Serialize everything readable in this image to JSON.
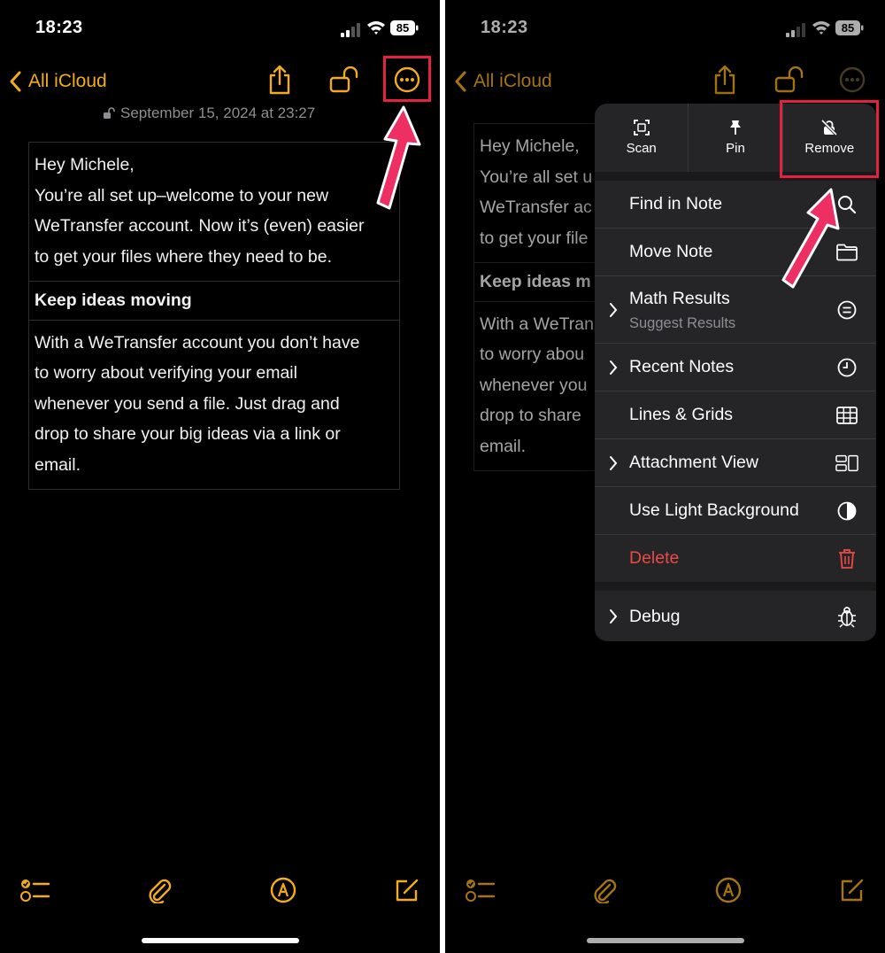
{
  "status": {
    "time": "18:23",
    "battery": "85"
  },
  "nav": {
    "back_label": "All iCloud"
  },
  "note": {
    "date": "September 15, 2024 at 23:27",
    "intro_lines": [
      "Hey Michele,",
      "You’re all set up–welcome to your new",
      "WeTransfer account. Now it’s (even) easier",
      "to get your files where they need to be."
    ],
    "heading": "Keep ideas moving",
    "body_lines": [
      "With a WeTransfer account you don’t have",
      "to worry about verifying your email",
      "whenever you send a file. Just drag and",
      "drop to share your big ideas via a link or",
      "email."
    ]
  },
  "right_note": {
    "intro_lines": [
      "Hey Michele,",
      "You’re all set u",
      "WeTransfer ac",
      "to get your file"
    ],
    "heading": "Keep ideas m",
    "body_lines": [
      "With a WeTran",
      "to worry abou",
      "whenever you",
      "drop to share",
      "email."
    ]
  },
  "menu": {
    "quick_actions": [
      {
        "label": "Scan",
        "icon": "scan-icon"
      },
      {
        "label": "Pin",
        "icon": "pin-icon"
      },
      {
        "label": "Remove",
        "icon": "lock-slash-icon"
      }
    ],
    "items": [
      {
        "label": "Find in Note",
        "icon": "search-icon"
      },
      {
        "label": "Move Note",
        "icon": "folder-icon"
      },
      {
        "label": "Math Results",
        "sublabel": "Suggest Results",
        "icon": "equals-circle-icon"
      },
      {
        "label": "Recent Notes",
        "icon": "clock-icon"
      },
      {
        "label": "Lines & Grids",
        "icon": "grid-icon"
      },
      {
        "label": "Attachment View",
        "icon": "attachment-view-icon"
      },
      {
        "label": "Use Light Background",
        "icon": "contrast-icon"
      },
      {
        "label": "Delete",
        "icon": "trash-icon"
      },
      {
        "label": "Debug",
        "icon": "bug-icon"
      }
    ]
  },
  "colors": {
    "accent": "#f5ac1a",
    "highlight": "#e8203f",
    "danger": "#eb4a45",
    "background": "#000000",
    "menu": "#252527"
  }
}
